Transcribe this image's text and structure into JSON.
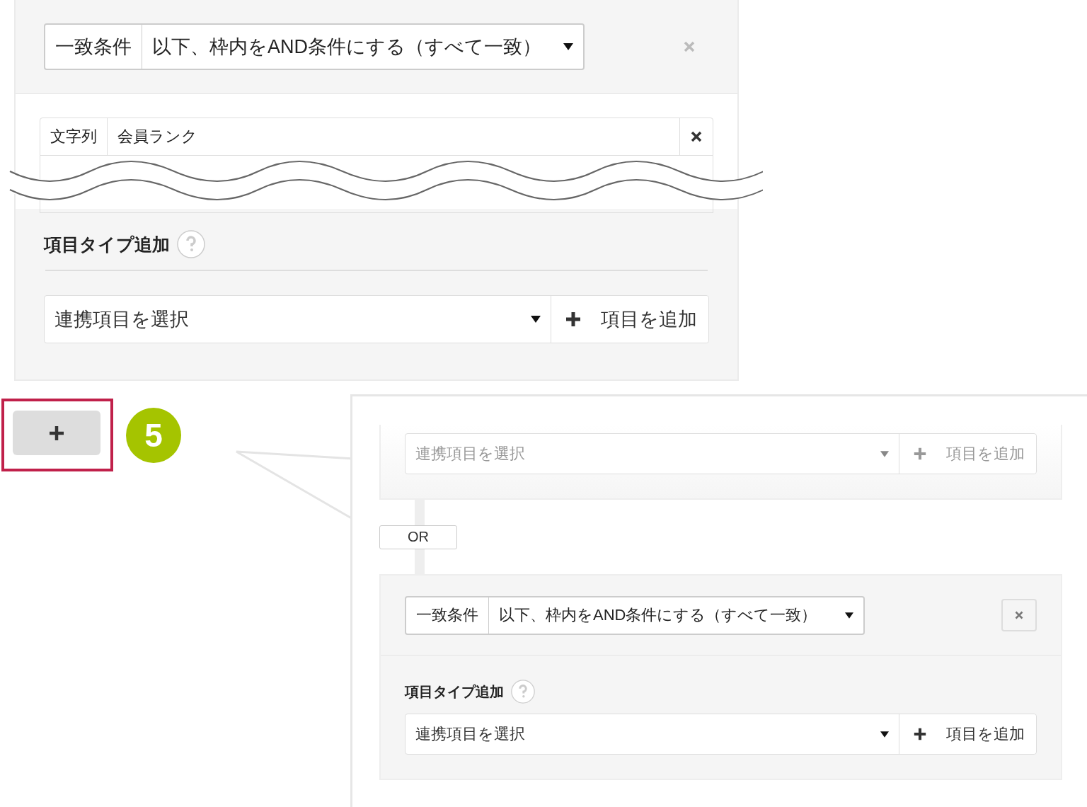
{
  "top_panel": {
    "condition": {
      "label": "一致条件",
      "value": "以下、枠内をAND条件にする（すべて一致）"
    },
    "field_row": {
      "type": "文字列",
      "name": "会員ランク"
    },
    "add_section": {
      "title": "項目タイプ追加",
      "select_placeholder": "連携項目を選択",
      "add_button": "項目を追加"
    }
  },
  "add_group_button": {
    "highlighted": true
  },
  "step_badge": "5",
  "callout": {
    "groups": [
      {
        "kind": "add_only",
        "disabled": true,
        "select_placeholder": "連携項目を選択",
        "add_button": "項目を追加"
      },
      {
        "kind": "connector",
        "label": "OR"
      },
      {
        "kind": "condition_group",
        "disabled": false,
        "condition": {
          "label": "一致条件",
          "value": "以下、枠内をAND条件にする（すべて一致）"
        },
        "title": "項目タイプ追加",
        "select_placeholder": "連携項目を選択",
        "add_button": "項目を追加"
      }
    ]
  }
}
